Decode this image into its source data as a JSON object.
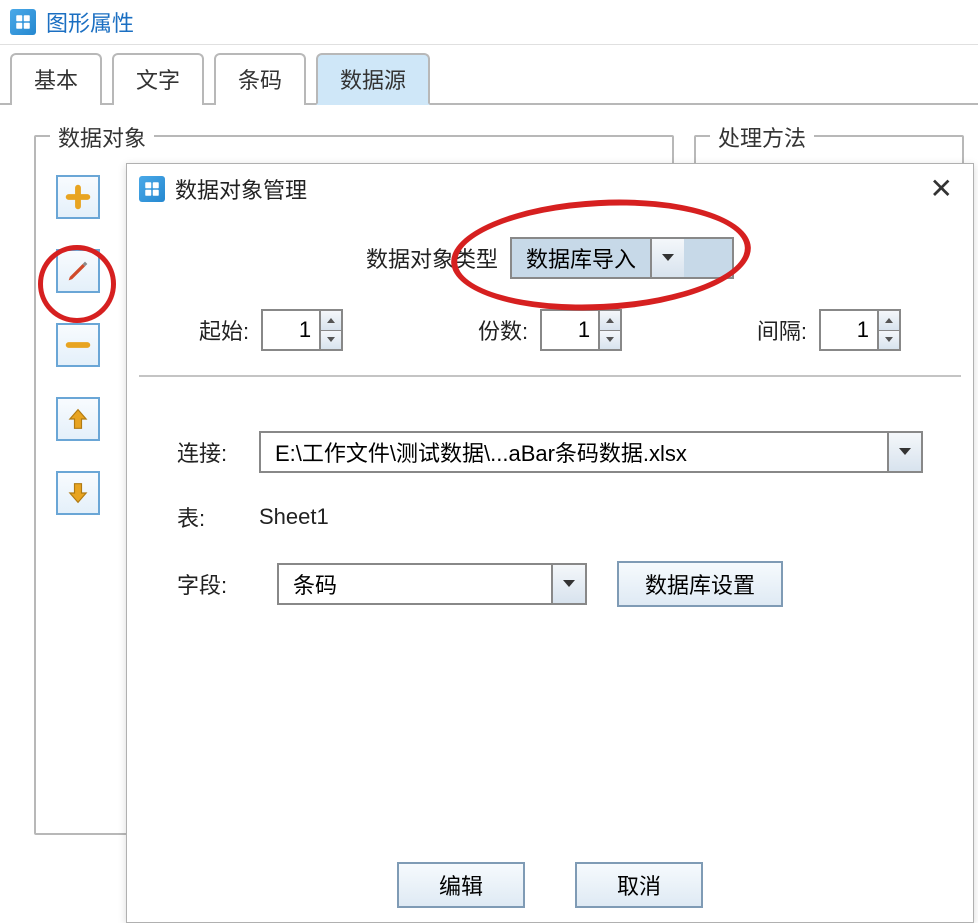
{
  "window": {
    "title": "图形属性"
  },
  "tabs": {
    "items": [
      "基本",
      "文字",
      "条码",
      "数据源"
    ],
    "active_index": 3
  },
  "groups": {
    "data_objects": "数据对象",
    "methods": "处理方法"
  },
  "toolbar": {
    "add": "add-icon",
    "edit": "edit-icon",
    "remove": "remove-icon",
    "up": "up-icon",
    "down": "down-icon"
  },
  "dialog": {
    "title": "数据对象管理",
    "type_label": "数据对象类型",
    "type_value": "数据库导入",
    "start_label": "起始:",
    "start_value": "1",
    "count_label": "份数:",
    "count_value": "1",
    "interval_label": "间隔:",
    "interval_value": "1",
    "conn_label": "连接:",
    "conn_value": "E:\\工作文件\\测试数据\\...aBar条码数据.xlsx",
    "table_label": "表:",
    "table_value": "Sheet1",
    "field_label": "字段:",
    "field_value": "条码",
    "db_settings": "数据库设置",
    "edit_btn": "编辑",
    "cancel_btn": "取消"
  }
}
